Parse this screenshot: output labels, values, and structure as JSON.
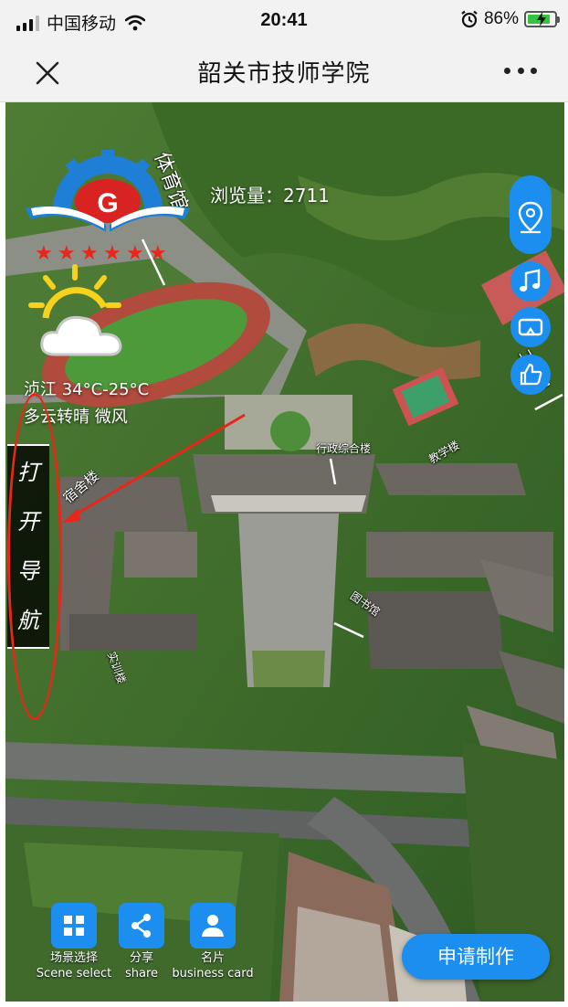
{
  "status_bar": {
    "carrier": "中国移动",
    "time": "20:41",
    "battery_percent": "86%",
    "battery_level": 0.86,
    "icons": [
      "signal-icon",
      "wifi-icon",
      "alarm-icon",
      "battery-icon"
    ]
  },
  "nav_bar": {
    "title": "韶关市技师学院",
    "icons": [
      "close-icon",
      "more-icon"
    ]
  },
  "panorama": {
    "views_label": "浏览量：",
    "views_count": "2711",
    "weather": {
      "temp": "浈江 34°C-25°C",
      "desc": "多云转晴 微风",
      "icon": "partly-cloudy-icon"
    },
    "open_nav": [
      "打",
      "开",
      "导",
      "航"
    ],
    "building_labels": [
      "行政综合楼",
      "教学楼",
      "图书馆",
      "宿舍楼",
      "体育馆",
      "工业园",
      "实训楼"
    ],
    "accent_color": "#1b8ef0",
    "highlight_color": "#e8261a"
  },
  "right_controls": [
    {
      "name": "location",
      "icon": "location-pin-icon"
    },
    {
      "name": "music",
      "icon": "music-note-icon"
    },
    {
      "name": "vr",
      "icon": "vr-glasses-icon"
    },
    {
      "name": "like",
      "icon": "thumbs-up-icon"
    }
  ],
  "bottom_actions": [
    {
      "label": "场景选择",
      "sub": "Scene select",
      "icon": "grid-icon"
    },
    {
      "label": "分享",
      "sub": "share",
      "icon": "share-icon"
    },
    {
      "label": "名片",
      "sub": "business card",
      "icon": "person-icon"
    }
  ],
  "apply_button": "申请制作"
}
